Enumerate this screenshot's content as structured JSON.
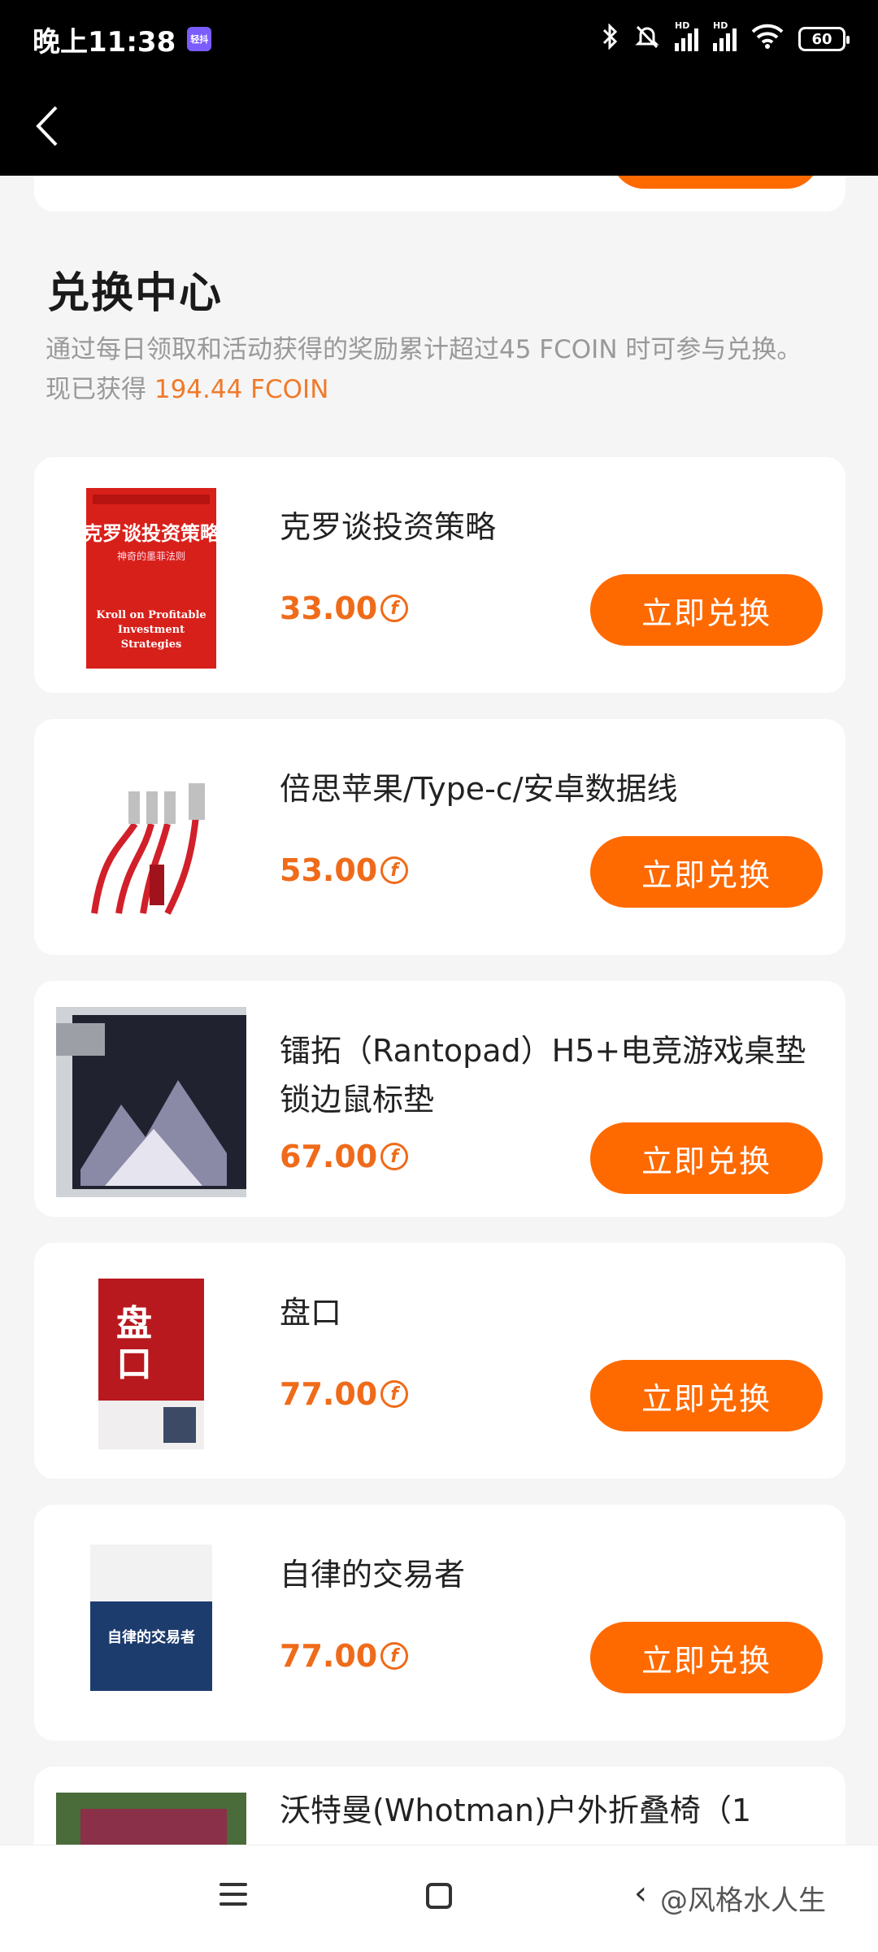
{
  "status_bar": {
    "time": "晚上11:38",
    "app_badge": "轻抖",
    "battery": "60"
  },
  "header": {
    "back_icon": "chevron-left-icon"
  },
  "exchange": {
    "title": "兑换中心",
    "description": "通过每日领取和活动获得的奖励累计超过45 FCOIN 时可参与兑换。现已获得",
    "earned": "194.44 FCOIN"
  },
  "items": [
    {
      "name": "克罗谈投资策略",
      "price": "33.00",
      "button": "立即兑换",
      "thumb": "book-cover-red"
    },
    {
      "name": "倍思苹果/Type-c/安卓数据线",
      "price": "53.00",
      "button": "立即兑换",
      "thumb": "usb-cable"
    },
    {
      "name": "镭拓（Rantopad）H5+电竞游戏桌垫锁边鼠标垫",
      "price": "67.00",
      "button": "立即兑换",
      "thumb": "mouse-pad"
    },
    {
      "name": "盘口",
      "price": "77.00",
      "button": "立即兑换",
      "thumb": "book-cover-red-white"
    },
    {
      "name": "自律的交易者",
      "price": "77.00",
      "button": "立即兑换",
      "thumb": "book-cover-blue"
    },
    {
      "name": "沃特曼(Whotman)户外折叠椅（1",
      "price": "",
      "button": "",
      "thumb": "folding-chair"
    }
  ],
  "coin_symbol": "f",
  "watermark": "@风格水人生",
  "colors": {
    "accent": "#ff6a00",
    "price": "#ef6b1a"
  }
}
